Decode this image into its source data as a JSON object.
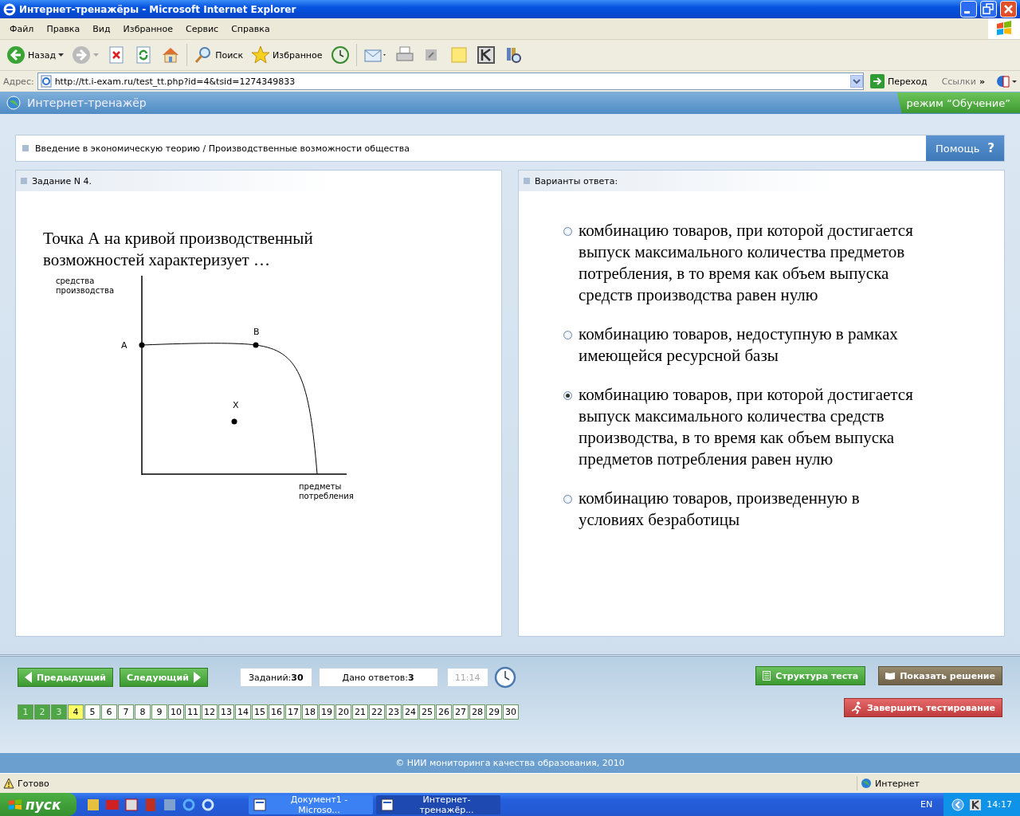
{
  "window": {
    "title": "Интернет-тренажёры - Microsoft Internet Explorer"
  },
  "menu": [
    "Файл",
    "Правка",
    "Вид",
    "Избранное",
    "Сервис",
    "Справка"
  ],
  "toolbar": [
    {
      "kind": "back",
      "label": "Назад"
    },
    {
      "kind": "forward"
    },
    {
      "kind": "stop"
    },
    {
      "kind": "refresh"
    },
    {
      "kind": "home"
    },
    {
      "kind": "search",
      "label": "Поиск"
    },
    {
      "kind": "favorites",
      "label": "Избранное"
    },
    {
      "kind": "history"
    },
    {
      "kind": "mail"
    },
    {
      "kind": "print"
    },
    {
      "kind": "edit"
    },
    {
      "kind": "note"
    },
    {
      "kind": "k"
    },
    {
      "kind": "research"
    }
  ],
  "address": {
    "label": "Адрес:",
    "url": "http://tt.i-exam.ru/test_tt.php?id=4&tsid=1274349833",
    "go": "Переход",
    "links": "Ссылки",
    "more": "»"
  },
  "app": {
    "title": "Интернет-тренажёр",
    "mode": "режим “Обучение”"
  },
  "breadcrumb": "Введение в экономическую теорию / Производственные возможности общества",
  "help": {
    "label": "Помощь",
    "icon": "?"
  },
  "task": {
    "heading": "Задание N 4.",
    "question": "Точка А на кривой производственный возможностей характеризует …",
    "figure": {
      "y_label": "средства производства",
      "x_label": "предметы потребления",
      "points": [
        "A",
        "B",
        "X"
      ]
    }
  },
  "answers": {
    "heading": "Варианты ответа:",
    "options": [
      {
        "text": "комбинацию товаров, при которой достигается выпуск максимального количества предметов потребления, в то время как объем выпуска средств производства равен нулю",
        "selected": false
      },
      {
        "text": "комбинацию товаров, недоступную в рамках имеющейся ресурсной базы",
        "selected": false
      },
      {
        "text": "комбинацию товаров, при которой достигается выпуск максимального количества средств производства, в то время как объем выпуска предметов потребления равен нулю",
        "selected": true
      },
      {
        "text": "комбинацию товаров, произведенную в условиях безработицы",
        "selected": false
      }
    ]
  },
  "nav": {
    "prev": "Предыдущий",
    "next": "Следующий",
    "tasks_label": "Заданий:",
    "tasks_count": "30",
    "answered_label": "Дано ответов:",
    "answered_count": "3",
    "time": "11:14",
    "structure": "Структура теста",
    "solution": "Показать решение",
    "finish": "Завершить тестирование"
  },
  "pages": [
    {
      "label": "1",
      "answered": true,
      "selected": false
    },
    {
      "label": "2",
      "answered": true,
      "selected": false
    },
    {
      "label": "3",
      "answered": true,
      "selected": false
    },
    {
      "label": "4",
      "answered": false,
      "selected": true
    },
    {
      "label": "5",
      "answered": false,
      "selected": false
    },
    {
      "label": "6",
      "answered": false,
      "selected": false
    },
    {
      "label": "7",
      "answered": false,
      "selected": false
    },
    {
      "label": "8",
      "answered": false,
      "selected": false
    },
    {
      "label": "9",
      "answered": false,
      "selected": false
    },
    {
      "label": "10",
      "answered": false,
      "selected": false
    },
    {
      "label": "11",
      "answered": false,
      "selected": false
    },
    {
      "label": "12",
      "answered": false,
      "selected": false
    },
    {
      "label": "13",
      "answered": false,
      "selected": false
    },
    {
      "label": "14",
      "answered": false,
      "selected": false
    },
    {
      "label": "15",
      "answered": false,
      "selected": false
    },
    {
      "label": "16",
      "answered": false,
      "selected": false
    },
    {
      "label": "17",
      "answered": false,
      "selected": false
    },
    {
      "label": "18",
      "answered": false,
      "selected": false
    },
    {
      "label": "19",
      "answered": false,
      "selected": false
    },
    {
      "label": "20",
      "answered": false,
      "selected": false
    },
    {
      "label": "21",
      "answered": false,
      "selected": false
    },
    {
      "label": "22",
      "answered": false,
      "selected": false
    },
    {
      "label": "23",
      "answered": false,
      "selected": false
    },
    {
      "label": "24",
      "answered": false,
      "selected": false
    },
    {
      "label": "25",
      "answered": false,
      "selected": false
    },
    {
      "label": "26",
      "answered": false,
      "selected": false
    },
    {
      "label": "27",
      "answered": false,
      "selected": false
    },
    {
      "label": "28",
      "answered": false,
      "selected": false
    },
    {
      "label": "29",
      "answered": false,
      "selected": false
    },
    {
      "label": "30",
      "answered": false,
      "selected": false
    }
  ],
  "footer": "© НИИ мониторинга качества образования, 2010",
  "status_bar": {
    "text": "Готово",
    "zone": "Интернет"
  },
  "taskbar": {
    "start": "пуск",
    "windows": [
      {
        "label": "Документ1 - Microso...",
        "selected": false
      },
      {
        "label": "Интернет-тренажёр...",
        "selected": true
      }
    ],
    "lang": "EN",
    "time": "14:17"
  }
}
